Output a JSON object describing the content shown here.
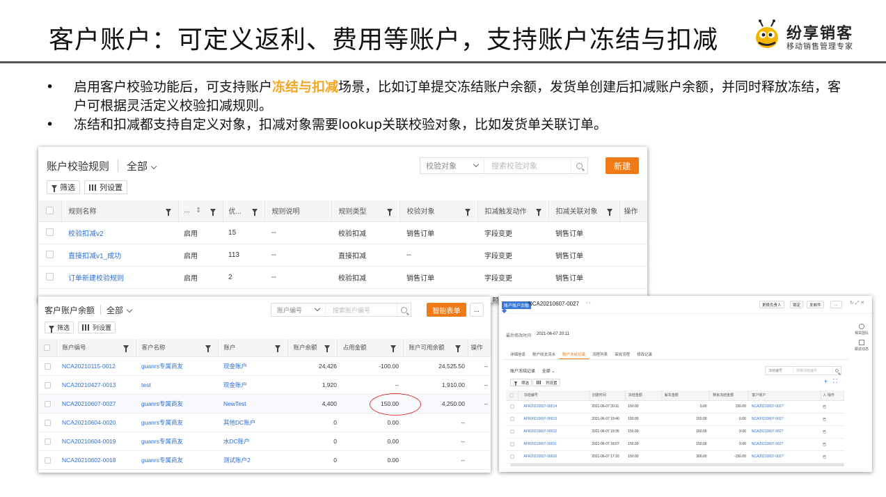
{
  "slide": {
    "title": "客户账户：可定义返利、费用等账户，支持账户冻结与扣减",
    "logo": {
      "brand": "纷享销客",
      "slogan": "移动销售管理专家"
    },
    "bullets": [
      {
        "dot": "•",
        "pre": "启用客户校验功能后，可支持账户",
        "highlight": "冻结与扣减",
        "post": "场景，比如订单提交冻结账户余额，发货单创建后扣减账户余额，并同时释放冻结，客户可根据灵活定义校验扣减规则。"
      },
      {
        "dot": "•",
        "text": "冻结和扣减都支持自定义对象，扣减对象需要lookup关联校验对象，比如发货单关联订单。"
      }
    ]
  },
  "rules_panel": {
    "title": "账户校验规则",
    "scope": "全部",
    "search_select": "校验对象",
    "search_placeholder": "搜索校验对象",
    "new_button": "新建",
    "filter_label": "筛选",
    "columns_label": "列设置",
    "headers": [
      "规则名称",
      "...",
      "优...",
      "规则说明",
      "规则类型",
      "校验对象",
      "扣减触发动作",
      "扣减关联对象",
      "操作"
    ],
    "rows": [
      [
        "校验扣减v2",
        "启用",
        "15",
        "--",
        "校验扣减",
        "销售订单",
        "字段变更",
        "销售订单"
      ],
      [
        "直接扣减v1_成功",
        "启用",
        "113",
        "--",
        "直接扣减",
        "--",
        "字段变更",
        "销售订单"
      ],
      [
        "订单新建校验规则",
        "启用",
        "2",
        "--",
        "校验扣减",
        "销售订单",
        "字段变更",
        "销售订单"
      ]
    ],
    "overflow_text": "额"
  },
  "balance_panel": {
    "title": "客户账户余额",
    "scope": "全部",
    "search_select": "账户编号",
    "search_placeholder": "搜索账户编号",
    "smart_button": "智能表单",
    "more_button": "...",
    "filter_label": "筛选",
    "columns_label": "列设置",
    "headers": [
      "账户编号",
      "客户名称",
      "账户",
      "账户余额",
      "占用金额",
      "账户可用余额",
      "操作"
    ],
    "rows": [
      [
        "NCA20210115-0012",
        "guanrs专属商友",
        "现金账户",
        "24,426",
        "-100.00",
        "24,525.50",
        "--"
      ],
      [
        "NCA20210427-0013",
        "test",
        "现金账户",
        "1,920",
        "--",
        "1,910.00",
        "--"
      ],
      [
        "NCA20210607-0027",
        "guanrs专属商友",
        "NewTest",
        "4,400",
        "150.00",
        "4,250.00",
        "--"
      ],
      [
        "NCA20210604-0020",
        "guanrs专属商友",
        "其他DC账户",
        "0",
        "0.00",
        "--",
        ""
      ],
      [
        "NCA20210604-0019",
        "guanrs专属商友",
        "水DC账户",
        "0",
        "0.00",
        "--",
        ""
      ],
      [
        "NCA20210602-0018",
        "guanrs专属商友",
        "测试账户2",
        "0",
        "0.00",
        "--",
        ""
      ]
    ]
  },
  "detail_panel": {
    "tag": "账户账户余额",
    "record_id": "NCA20210607-0027",
    "actions": [
      "更换负责人",
      "锁定",
      "发邮件",
      "..."
    ],
    "side_labels": [
      "相关团队",
      "跟进动态"
    ],
    "modified_label": "最后修改时间",
    "modified_value": "2021-06-07 20:11",
    "tabs": [
      "详细信息",
      "账户收支流水",
      "账户冻结记录",
      "流程列表",
      "审批流程",
      "修改记录"
    ],
    "active_tab": 2,
    "sub_title": "账户冻结记录",
    "sub_scope": "全部",
    "sub_search_select": "冻结编号",
    "sub_search_placeholder": "搜索冻结编号",
    "filter_label": "筛选",
    "columns_label": "列设置",
    "headers": [
      "冻结编号",
      "创建时间",
      "冻结金额",
      "解冻金额",
      "剩余冻结金额",
      "客户账户",
      "入",
      "操作"
    ],
    "rows": [
      [
        "AFR20210607-00014",
        "2021-06-07 20:11",
        "150.00",
        "0.00",
        "150.00",
        "NCA20210607-0027",
        "已"
      ],
      [
        "AFR20210607-00013",
        "2021-06-07 19:40",
        "150.00",
        "150.00",
        "0.00",
        "NCA20210607-0027",
        "已"
      ],
      [
        "AFR20210607-00012",
        "2021-06-07 19:35",
        "150.00",
        "150.00",
        "0.00",
        "NCA20210607-0027",
        "已"
      ],
      [
        "AFR20210607-00011",
        "2021-06-07 18:07",
        "150.00",
        "150.00",
        "0.00",
        "NCA20210607-0027",
        "已"
      ],
      [
        "AFR20210607-00010",
        "2021-06-07 17:16",
        "150.00",
        "300.00",
        "-150.00",
        "NCA20210607-0027",
        "已"
      ]
    ]
  },
  "colors": {
    "accent": "#f07a16",
    "highlight": "#f5a623",
    "link": "#2f6fd0",
    "circle": "#d9342b"
  }
}
